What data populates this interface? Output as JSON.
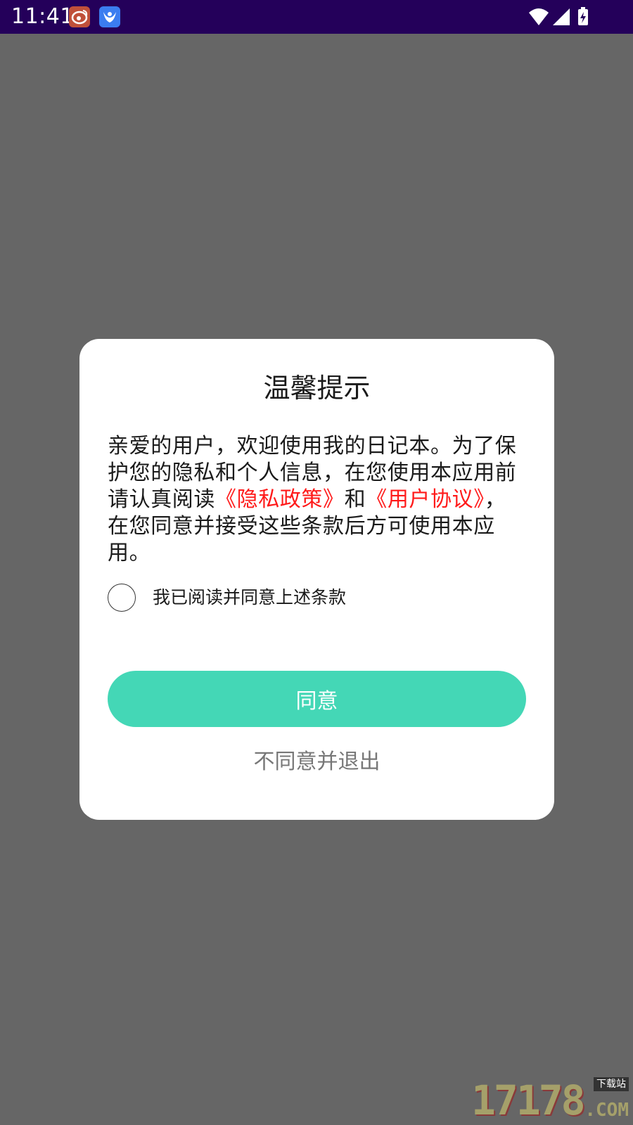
{
  "status_bar": {
    "time": "11:41",
    "notifications": [
      "weibo-icon",
      "app-bird-icon"
    ],
    "indicators": [
      "wifi-icon",
      "cell-signal-icon",
      "battery-charging-icon"
    ]
  },
  "dialog": {
    "title": "温馨提示",
    "body": {
      "text_1": "亲爱的用户，欢迎使用我的日记本。为了保护您的隐私和个人信息，在您使用本应用前请认真阅读",
      "privacy_link": "《隐私政策》",
      "text_2": "和",
      "terms_link": "《用户协议》",
      "text_3": "，在您同意并接受这些条款后方可使用本应用。"
    },
    "checkbox_label": "我已阅读并同意上述条款",
    "checkbox_checked": false,
    "agree_button": "同意",
    "decline_link": "不同意并退出"
  },
  "watermark": {
    "number": "17178",
    "tag": "下载站",
    "domain": ".COM"
  },
  "colors": {
    "status_bar_bg": "#24005a",
    "overlay_bg": "#666666",
    "dialog_bg": "#ffffff",
    "accent": "#44d7b6",
    "link": "#ff1a1a",
    "muted_text": "#777777"
  }
}
